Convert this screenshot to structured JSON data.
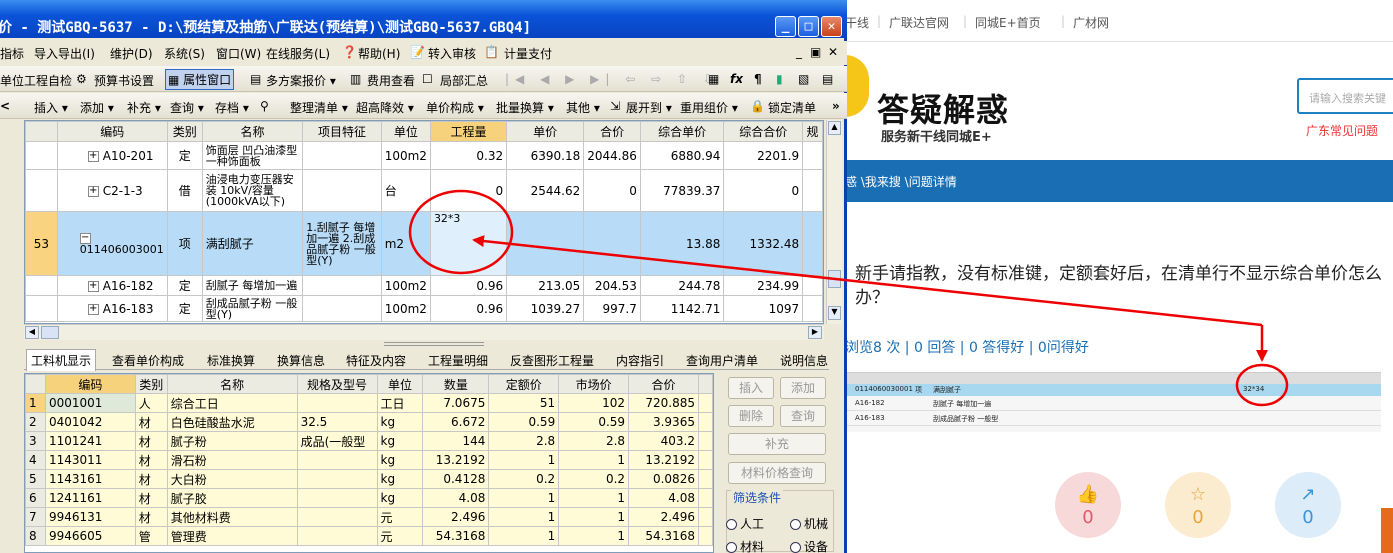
{
  "window": {
    "title": "价 - 测试GBQ-5637 - D:\\预结算及抽筋\\广联达(预结算)\\测试GBQ-5637.GBQ4]"
  },
  "menu": [
    "指标",
    "导入导出(I)",
    "维护(D)",
    "系统(S)",
    "窗口(W)",
    "在线服务(L)",
    "帮助(H)",
    "转入审核",
    "计量支付"
  ],
  "toolbar1": [
    "单位工程自检",
    "预算书设置",
    "属性窗口",
    "多方案报价 ▾",
    "费用查看",
    "局部汇总"
  ],
  "toolbar2": [
    "插入 ▾",
    "添加 ▾",
    "补充 ▾",
    "查询 ▾",
    "存档 ▾",
    "整理清单 ▾",
    "超高降效 ▾",
    "单价构成 ▾",
    "批量换算 ▾",
    "其他 ▾",
    "展开到 ▾",
    "重用组价 ▾",
    "锁定清单"
  ],
  "grid": {
    "headers": [
      "编码",
      "类别",
      "名称",
      "项目特征",
      "单位",
      "工程量",
      "单价",
      "合价",
      "综合单价",
      "综合合价",
      "规"
    ],
    "rows": [
      {
        "no": "",
        "code": "A10-201",
        "type": "定",
        "name": "饰面层 凹凸油漆型 一种饰面板",
        "feature": "",
        "unit": "100m2",
        "qty": "0.32",
        "price": "6390.18",
        "total": "2044.86",
        "cprice": "6880.94",
        "ctotal": "2201.9"
      },
      {
        "no": "",
        "code": "C2-1-3",
        "type": "借",
        "name": "油浸电力变压器安装 10kV/容量(1000kVA以下)",
        "feature": "",
        "unit": "台",
        "qty": "0",
        "price": "2544.62",
        "total": "0",
        "cprice": "77839.37",
        "ctotal": "0"
      },
      {
        "no": "53",
        "code": "011406003001",
        "type": "项",
        "name": "满刮腻子",
        "feature": "1.刮腻子 每增加一遍 2.刮成品腻子粉 一般型(Y)",
        "unit": "m2",
        "qty": "32*3",
        "price": "",
        "total": "",
        "cprice": "13.88",
        "ctotal": "1332.48"
      },
      {
        "no": "",
        "code": "A16-182",
        "type": "定",
        "name": "刮腻子 每增加一遍",
        "feature": "",
        "unit": "100m2",
        "qty": "0.96",
        "price": "213.05",
        "total": "204.53",
        "cprice": "244.78",
        "ctotal": "234.99"
      },
      {
        "no": "",
        "code": "A16-183",
        "type": "定",
        "name": "刮成品腻子粉 一般型(Y)",
        "feature": "",
        "unit": "100m2",
        "qty": "0.96",
        "price": "1039.27",
        "total": "997.7",
        "cprice": "1142.71",
        "ctotal": "1097"
      }
    ]
  },
  "tabs": [
    "工料机显示",
    "查看单价构成",
    "标准换算",
    "换算信息",
    "特征及内容",
    "工程量明细",
    "反查图形工程量",
    "内容指引",
    "查询用户清单",
    "说明信息"
  ],
  "lgrid": {
    "headers": [
      "编码",
      "类别",
      "名称",
      "规格及型号",
      "单位",
      "数量",
      "定额价",
      "市场价",
      "合价"
    ],
    "rows": [
      [
        "1",
        "0001001",
        "人",
        "综合工日",
        "",
        "工日",
        "7.0675",
        "51",
        "102",
        "720.885"
      ],
      [
        "2",
        "0401042",
        "材",
        "白色硅酸盐水泥",
        "32.5",
        "kg",
        "6.672",
        "0.59",
        "0.59",
        "3.9365"
      ],
      [
        "3",
        "1101241",
        "材",
        "腻子粉",
        "成品(一般型",
        "kg",
        "144",
        "2.8",
        "2.8",
        "403.2"
      ],
      [
        "4",
        "1143011",
        "材",
        "滑石粉",
        "",
        "kg",
        "13.2192",
        "1",
        "1",
        "13.2192"
      ],
      [
        "5",
        "1143161",
        "材",
        "大白粉",
        "",
        "kg",
        "0.4128",
        "0.2",
        "0.2",
        "0.0826"
      ],
      [
        "6",
        "1241161",
        "材",
        "腻子胶",
        "",
        "kg",
        "4.08",
        "1",
        "1",
        "4.08"
      ],
      [
        "7",
        "9946131",
        "材",
        "其他材料费",
        "",
        "元",
        "2.496",
        "1",
        "1",
        "2.496"
      ],
      [
        "8",
        "9946605",
        "管",
        "管理费",
        "",
        "元",
        "54.3168",
        "1",
        "1",
        "54.3168"
      ]
    ]
  },
  "side": {
    "insert": "插入",
    "add": "添加",
    "delete": "删除",
    "query": "查询",
    "supplement": "补充",
    "price_query": "材料价格查询",
    "filter": "筛选条件",
    "labor": "人工",
    "machine": "机械",
    "material": "材料",
    "device": "设备"
  },
  "web": {
    "links": [
      "干线",
      "广联达官网",
      "同城E+首页",
      "广材网"
    ],
    "title": "答疑解惑",
    "subtitle": "服务新干线同城E+",
    "search_placeholder": "请输入搜索关键",
    "hot": "广东常见问题",
    "breadcrumb": "惑 \\我来搜 \\问题详情",
    "question": "新手请指教，没有标准键，定额套好后，在清单行不显示综合单价怎么办？",
    "stats": "浏览8 次 | 0 回答 | 0 答得好 | 0问得好",
    "likes": "0",
    "stars": "0",
    "shares": "0"
  }
}
